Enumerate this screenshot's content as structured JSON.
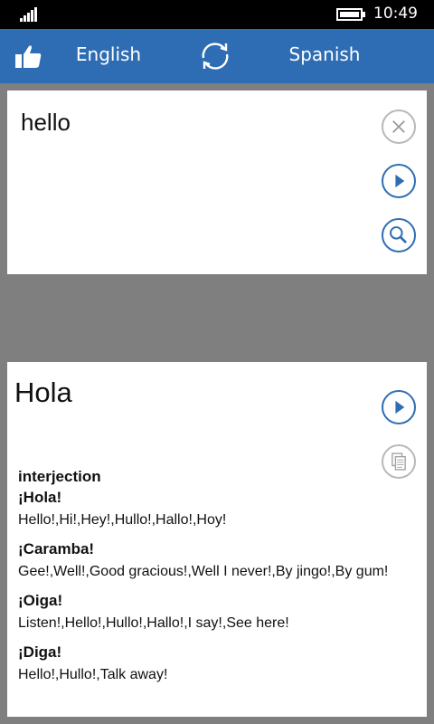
{
  "status": {
    "time": "10:49"
  },
  "header": {
    "source_lang": "English",
    "target_lang": "Spanish"
  },
  "input": {
    "text": "hello"
  },
  "output": {
    "translation": "Hola",
    "part_of_speech": "interjection",
    "entries": [
      {
        "headword": "¡Hola!",
        "synonyms": "Hello!,Hi!,Hey!,Hullo!,Hallo!,Hoy!"
      },
      {
        "headword": "¡Caramba!",
        "synonyms": "Gee!,Well!,Good gracious!,Well I never!,By jingo!,By gum!"
      },
      {
        "headword": "¡Oiga!",
        "synonyms": "Listen!,Hello!,Hullo!,Hallo!,I say!,See here!"
      },
      {
        "headword": "¡Diga!",
        "synonyms": "Hello!,Hullo!,Talk away!"
      }
    ]
  },
  "colors": {
    "accent": "#2e6db3",
    "background": "#7f7f7f"
  },
  "icons": [
    "signal-icon",
    "battery-icon",
    "thumbs-up-icon",
    "swap-icon",
    "close-icon",
    "play-icon",
    "search-icon",
    "copy-icon"
  ]
}
